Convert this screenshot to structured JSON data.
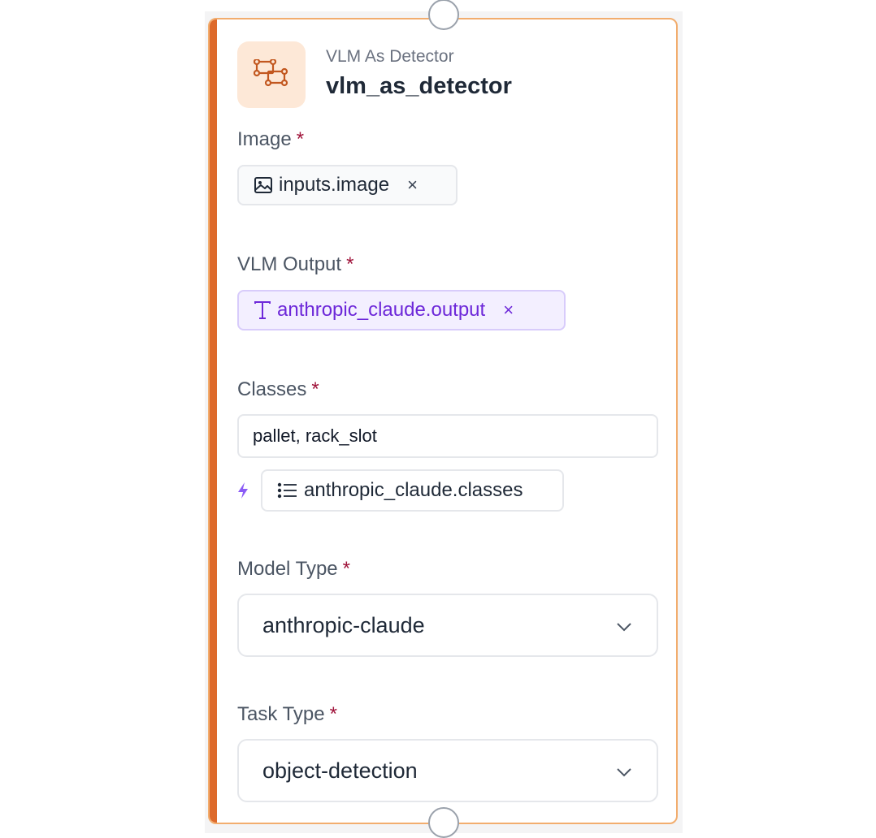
{
  "node": {
    "type_label": "VLM As Detector",
    "name": "vlm_as_detector",
    "icon": "bounding-boxes-icon",
    "accent_color": "#dd6a2b",
    "border_color": "#f2ad6e",
    "icon_bg": "#fde8d7"
  },
  "fields": {
    "image": {
      "label": "Image",
      "required_mark": "*",
      "chip_value": "inputs.image",
      "chip_icon": "image-icon",
      "remove_glyph": "×"
    },
    "vlm_output": {
      "label": "VLM Output",
      "required_mark": "*",
      "chip_value": "anthropic_claude.output",
      "chip_icon": "text-type-icon",
      "remove_glyph": "×",
      "chip_color": "#6d28d9"
    },
    "classes": {
      "label": "Classes",
      "required_mark": "*",
      "input_value": "pallet, rack_slot",
      "suggestion_icon": "lightning-icon",
      "suggestion_chip_icon": "list-icon",
      "suggestion_chip_value": "anthropic_claude.classes"
    },
    "model_type": {
      "label": "Model Type",
      "required_mark": "*",
      "selected": "anthropic-claude",
      "icon": "chevron-down-icon"
    },
    "task_type": {
      "label": "Task Type",
      "required_mark": "*",
      "selected": "object-detection",
      "icon": "chevron-down-icon"
    }
  }
}
